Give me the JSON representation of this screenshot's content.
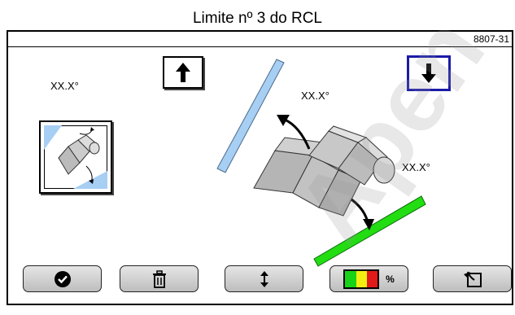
{
  "title": "Limite nº 3 do RCL",
  "figure_code": "8807-31",
  "angle_labels": {
    "left": "XX.X°",
    "middle": "XX.X°",
    "right": "XX.X°"
  },
  "icons": {
    "arrow_up": "arrow-up-icon",
    "arrow_down": "arrow-down-icon",
    "table_motion": "table-motion-icon",
    "confirm": "check-circle-icon",
    "delete": "trash-icon",
    "reset_height": "up-down-icon",
    "battery": "battery-icon",
    "back": "back-icon"
  },
  "bottom_bar": {
    "battery_label": "%"
  },
  "colors": {
    "selected_border": "#1b1ba8",
    "upper_limit_bar": "#a7cef3",
    "lower_limit_bar": "#22dd11",
    "battery_green": "#17d317",
    "battery_yellow": "#f2ee12",
    "battery_red": "#e01919"
  },
  "watermark": "Apen"
}
